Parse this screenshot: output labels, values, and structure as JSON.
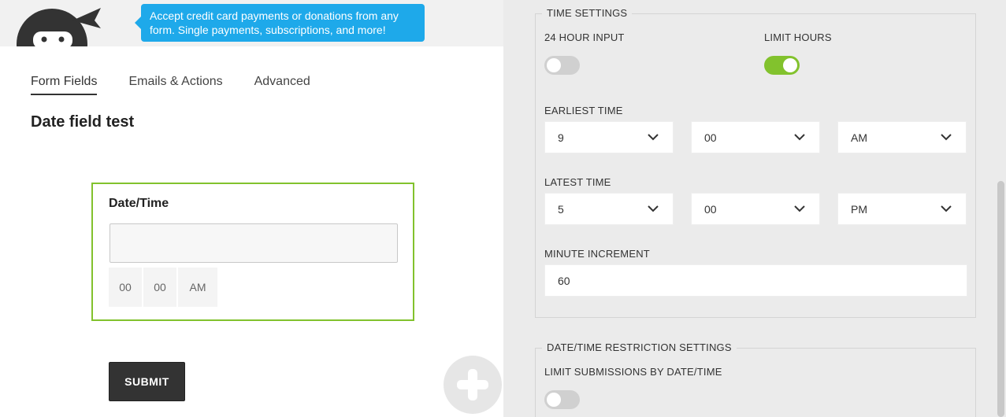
{
  "promo": {
    "tooltip": "Accept credit card payments or donations from any form. Single payments, subscriptions, and more!"
  },
  "tabs": [
    {
      "label": "Form Fields",
      "active": true
    },
    {
      "label": "Emails & Actions",
      "active": false
    },
    {
      "label": "Advanced",
      "active": false
    }
  ],
  "form": {
    "title": "Date field test",
    "field": {
      "label": "Date/Time",
      "value": "",
      "hour": "00",
      "minute": "00",
      "ampm": "AM"
    },
    "submit_label": "SUBMIT"
  },
  "icons": {
    "add": "plus-icon",
    "chevron": "chevron-down-icon",
    "logo": "ninja-logo-icon"
  },
  "colors": {
    "accent_green": "#82c22d",
    "tooltip_blue": "#1ea9ea",
    "submit_dark": "#333333"
  },
  "time_settings": {
    "legend": "TIME SETTINGS",
    "hour24_label": "24 HOUR INPUT",
    "hour24_on": false,
    "limit_hours_label": "LIMIT HOURS",
    "limit_hours_on": true,
    "earliest_label": "EARLIEST TIME",
    "earliest": {
      "hour": "9",
      "minute": "00",
      "ampm": "AM"
    },
    "latest_label": "LATEST TIME",
    "latest": {
      "hour": "5",
      "minute": "00",
      "ampm": "PM"
    },
    "increment_label": "MINUTE INCREMENT",
    "increment_value": "60"
  },
  "restriction_settings": {
    "legend": "DATE/TIME RESTRICTION SETTINGS",
    "limit_label": "LIMIT SUBMISSIONS BY DATE/TIME",
    "limit_on": false
  }
}
